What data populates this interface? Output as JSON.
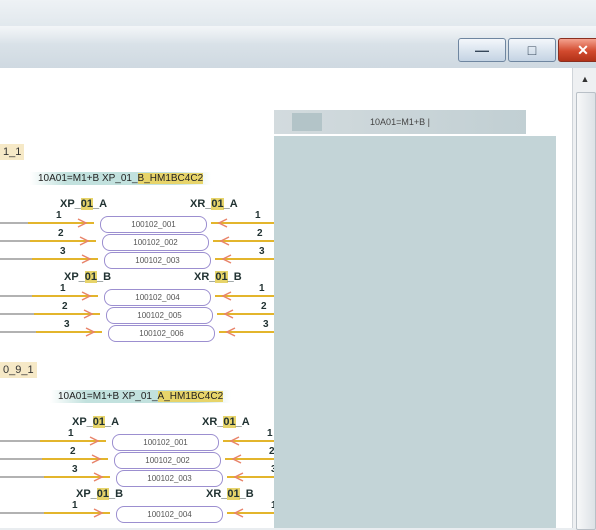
{
  "window": {
    "minimize_glyph": "—",
    "maximize_glyph": "□",
    "close_glyph": "✕"
  },
  "scrollbar": {
    "up_glyph": "▲"
  },
  "side_labels": [
    "1_1",
    "0_9_1"
  ],
  "panel": {
    "tab_label": "10A01=M1+B |"
  },
  "groups": [
    {
      "header_pre": "10A01=M1+B",
      "header_mid": "XP_01_",
      "header_hl": "B_HM1BC4C2",
      "blocks": [
        {
          "left_pre": "XP_",
          "left_hl": "01",
          "left_post": "_A",
          "right_pre": "XR_",
          "right_hl": "01",
          "right_post": "_A",
          "wires": [
            "100102_001",
            "100102_002",
            "100102_003"
          ]
        },
        {
          "left_pre": "XP_",
          "left_hl": "01",
          "left_post": "_B",
          "right_pre": "XR_",
          "right_hl": "01",
          "right_post": "_B",
          "wires": [
            "100102_004",
            "100102_005",
            "100102_006"
          ]
        }
      ]
    },
    {
      "header_pre": "10A01=M1+B",
      "header_mid": "XP_01_",
      "header_hl": "A_HM1BC4C2",
      "blocks": [
        {
          "left_pre": "XP_",
          "left_hl": "01",
          "left_post": "_A",
          "right_pre": "XR_",
          "right_hl": "01",
          "right_post": "_A",
          "wires": [
            "100102_001",
            "100102_002",
            "100102_003"
          ]
        },
        {
          "left_pre": "XP_",
          "left_hl": "01",
          "left_post": "_B",
          "right_pre": "XR_",
          "right_hl": "01",
          "right_post": "_B",
          "wires": [
            "100102_004"
          ]
        }
      ]
    }
  ],
  "pins": [
    "1",
    "2",
    "3"
  ],
  "colors": {
    "wire_line": "#e3b52c",
    "arrow": "#e8846a",
    "wire_border": "#9c8fd0",
    "panel": "#c3d4d7",
    "highlight": "#e7d46a"
  }
}
